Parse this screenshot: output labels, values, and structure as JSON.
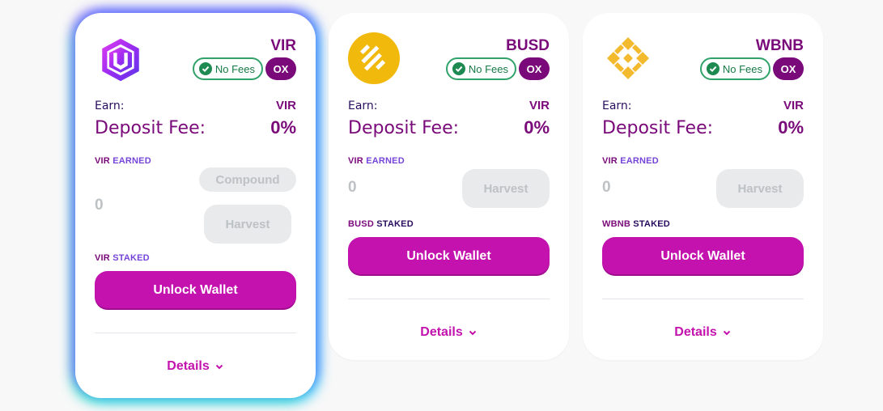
{
  "cards": [
    {
      "token_name": "VIR",
      "logo": "vir-hexagon-logo",
      "nofees_label": "No Fees",
      "ox_label": "OX",
      "earn_label": "Earn:",
      "earn_value": "VIR",
      "fee_label": "Deposit Fee:",
      "fee_value": "0%",
      "earned_token": "VIR",
      "earned_rest": "EARNED",
      "earned_value": "0",
      "compound_label": "Compound",
      "harvest_label": "Harvest",
      "staked_token": "VIR",
      "staked_rest": "STAKED",
      "unlock_label": "Unlock Wallet",
      "details_label": "Details"
    },
    {
      "token_name": "BUSD",
      "logo": "busd-coin-logo",
      "nofees_label": "No Fees",
      "ox_label": "OX",
      "earn_label": "Earn:",
      "earn_value": "VIR",
      "fee_label": "Deposit Fee:",
      "fee_value": "0%",
      "earned_token": "VIR",
      "earned_rest": "EARNED",
      "earned_value": "0",
      "harvest_label": "Harvest",
      "staked_token": "BUSD",
      "staked_rest": "STAKED",
      "unlock_label": "Unlock Wallet",
      "details_label": "Details"
    },
    {
      "token_name": "WBNB",
      "logo": "bnb-logo",
      "nofees_label": "No Fees",
      "ox_label": "OX",
      "earn_label": "Earn:",
      "earn_value": "VIR",
      "fee_label": "Deposit Fee:",
      "fee_value": "0%",
      "earned_token": "VIR",
      "earned_rest": "EARNED",
      "earned_value": "0",
      "harvest_label": "Harvest",
      "staked_token": "WBNB",
      "staked_rest": "STAKED",
      "unlock_label": "Unlock Wallet",
      "details_label": "Details"
    }
  ],
  "colors": {
    "accent": "#c312ad",
    "title": "#7a0a7a",
    "nofees_border": "#31a36a",
    "disabled_bg": "#e9eaeb"
  }
}
